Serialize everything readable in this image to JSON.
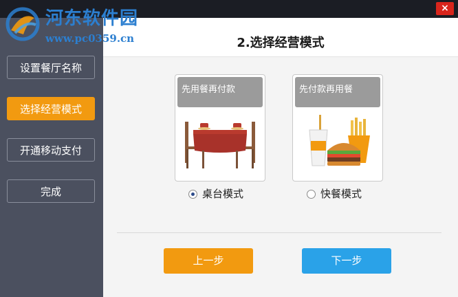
{
  "titlebar": {
    "close_label": "×"
  },
  "watermark": {
    "site_name": "河东软件园",
    "url": "www.pc0359.cn"
  },
  "sidebar": {
    "items": [
      {
        "label": "设置餐厅名称",
        "active": false
      },
      {
        "label": "选择经营模式",
        "active": true
      },
      {
        "label": "开通移动支付",
        "active": false
      },
      {
        "label": "完成",
        "active": false
      }
    ]
  },
  "main": {
    "title": "2.选择经营模式",
    "options": [
      {
        "card_label": "先用餐再付款",
        "radio_label": "桌台模式",
        "selected": true,
        "icon": "dining-table-icon"
      },
      {
        "card_label": "先付款再用餐",
        "radio_label": "快餐模式",
        "selected": false,
        "icon": "fast-food-icon"
      }
    ],
    "prev_label": "上一步",
    "next_label": "下一步"
  },
  "colors": {
    "accent_orange": "#f29a10",
    "accent_blue": "#2aa2e8",
    "sidebar_bg": "#4b505f",
    "titlebar_bg": "#1b1d24",
    "close_red": "#d9251c"
  }
}
